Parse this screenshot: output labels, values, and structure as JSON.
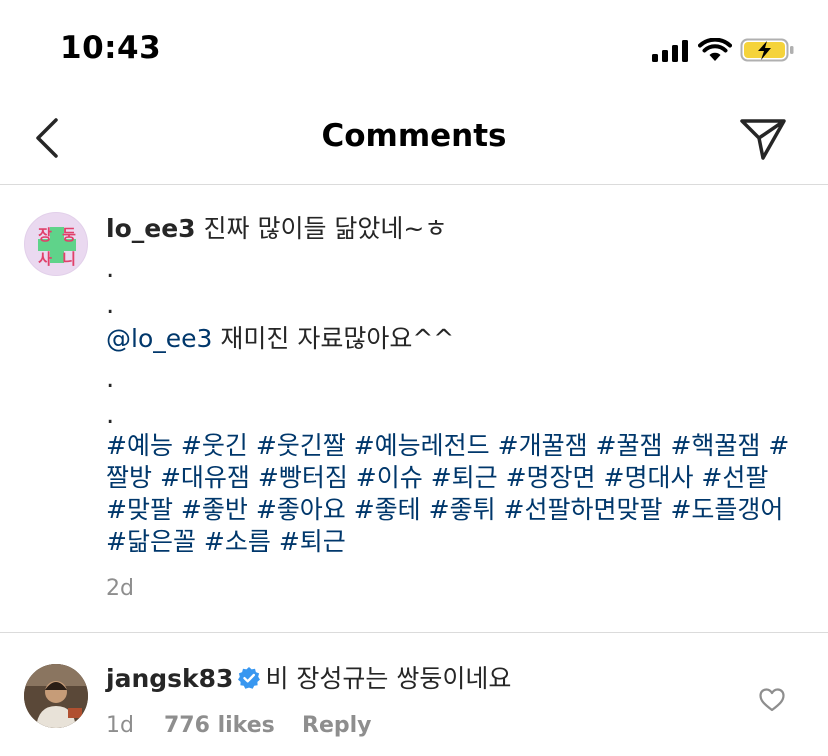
{
  "status_bar": {
    "time": "10:43"
  },
  "nav": {
    "title": "Comments"
  },
  "comment1": {
    "avatar_text": [
      "장",
      "둥",
      "사",
      "니"
    ],
    "username": "lo_ee3",
    "text": " 진짜 많이들 닮았네~ㅎ",
    "dot": ".",
    "mention": "@lo_ee3",
    "mention_text": " 재미진 자료많아요^^",
    "hashtags": [
      "#예능",
      "#웃긴",
      "#웃긴짤",
      "#예능레전드",
      "#개꿀잼",
      " #꿀잼",
      "#핵꿀잼",
      "#짤방",
      "#대유잼",
      "#빵터짐",
      "#이슈",
      "#퇴근",
      "#명장면",
      "#명대사",
      "#선팔",
      "#맞팔",
      "#좋반",
      "#좋아요",
      "#좋테",
      "#좋튀",
      "#선팔하면맞팔",
      "#도플갱어",
      "#닮은꼴",
      "#소름",
      "#퇴근"
    ],
    "time": "2d"
  },
  "comment2": {
    "username": "jangsk83",
    "text": "비 장성규는 쌍둥이네요",
    "time": "1d",
    "likes": "776 likes",
    "reply": "Reply"
  },
  "colors": {
    "link": "#00376b",
    "meta": "#8e8e8e",
    "verified": "#3897f0",
    "battery": "#f5d33b"
  }
}
